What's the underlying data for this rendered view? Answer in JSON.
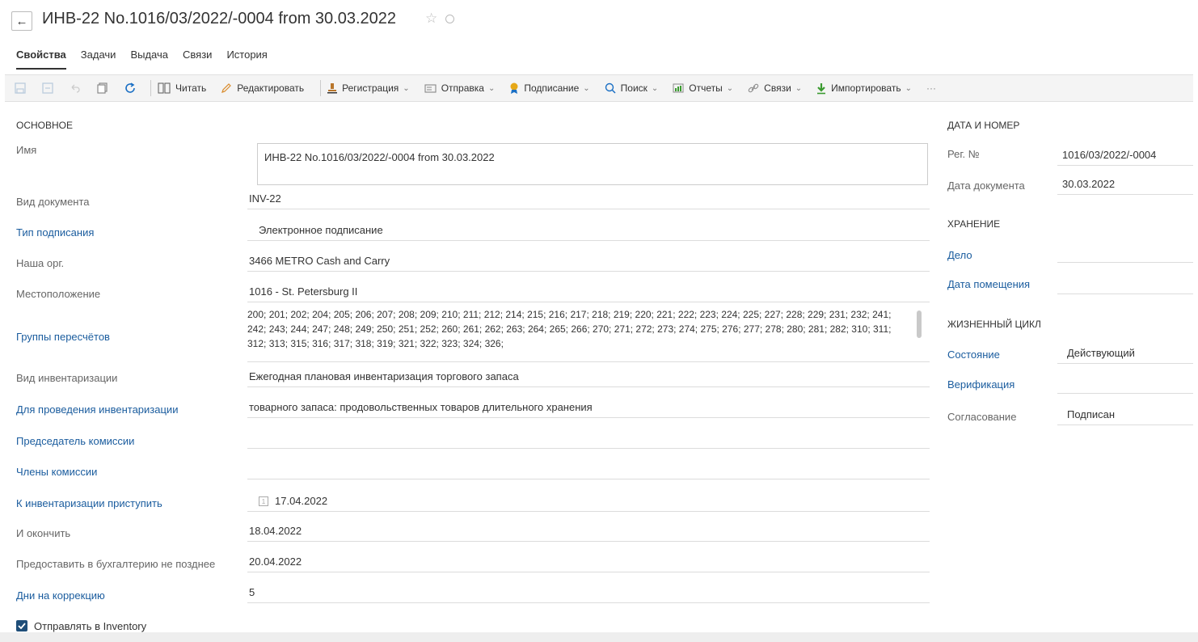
{
  "header": {
    "title": "ИНВ-22 No.1016/03/2022/-0004 from 30.03.2022",
    "tabs": [
      "Свойства",
      "Задачи",
      "Выдача",
      "Связи",
      "История"
    ]
  },
  "toolbar": {
    "read": "Читать",
    "edit": "Редактировать",
    "registration": "Регистрация",
    "send": "Отправка",
    "sign": "Подписание",
    "search": "Поиск",
    "reports": "Отчеты",
    "links": "Связи",
    "import": "Импортировать",
    "more": "···"
  },
  "main": {
    "section": "ОСНОВНОЕ",
    "fields": {
      "name_label": "Имя",
      "name_value": "ИНВ-22 No.1016/03/2022/-0004 from 30.03.2022",
      "doc_type_label": "Вид документа",
      "doc_type_value": "INV-22",
      "sign_type_label": "Тип подписания",
      "sign_type_value": "Электронное подписание",
      "our_org_label": "Наша орг.",
      "our_org_value": "3466 METRO Cash and Carry",
      "location_label": "Местоположение",
      "location_value": "1016 - St. Petersburg II",
      "groups_label": "Группы пересчётов",
      "groups_value": "200; 201; 202; 204; 205; 206; 207; 208; 209; 210; 211; 212; 214; 215; 216; 217; 218; 219; 220; 221; 222; 223; 224; 225; 227; 228; 229; 231; 232; 241; 242; 243; 244; 247; 248; 249; 250; 251; 252; 260; 261; 262; 263; 264; 265; 266; 270; 271; 272; 273; 274; 275; 276; 277; 278; 280; 281; 282; 310; 311; 312; 313; 315; 316; 317; 318; 319; 321; 322; 323; 324; 326;",
      "inv_type_label": "Вид инвентаризации",
      "inv_type_value": "Ежегодная плановая инвентаризация торгового запаса",
      "purpose_label": "Для проведения инвентаризации",
      "purpose_value": "товарного запаса: продовольственных товаров длительного хранения",
      "chairman_label": "Председатель комиссии",
      "chairman_value": "",
      "members_label": "Члены комиссии",
      "members_value": "",
      "start_label": "К инвентаризации приступить",
      "start_value": "17.04.2022",
      "end_label": "И окончить",
      "end_value": "18.04.2022",
      "deadline_label": "Предоставить в бухгалтерию не позднее",
      "deadline_value": "20.04.2022",
      "correction_label": "Дни на коррекцию",
      "correction_value": "5",
      "send_inventory_label": "Отправлять в Inventory"
    }
  },
  "side": {
    "date_section": "ДАТА И НОМЕР",
    "reg_label": "Рег. №",
    "reg_value": "1016/03/2022/-0004",
    "date_label": "Дата документа",
    "date_value": "30.03.2022",
    "storage_section": "ХРАНЕНИЕ",
    "case_label": "Дело",
    "case_value": "",
    "placed_label": "Дата помещения",
    "placed_value": "",
    "lifecycle_section": "ЖИЗНЕННЫЙ ЦИКЛ",
    "state_label": "Состояние",
    "state_value": "Действующий",
    "verify_label": "Верификация",
    "verify_value": "",
    "approval_label": "Согласование",
    "approval_value": "Подписан"
  },
  "colors": {
    "link": "#1a5c9e",
    "checkbox": "#1f4e79",
    "sign_icon": "#e6a817",
    "import_icon": "#3a9a2f",
    "search_icon": "#1a6fc4"
  }
}
